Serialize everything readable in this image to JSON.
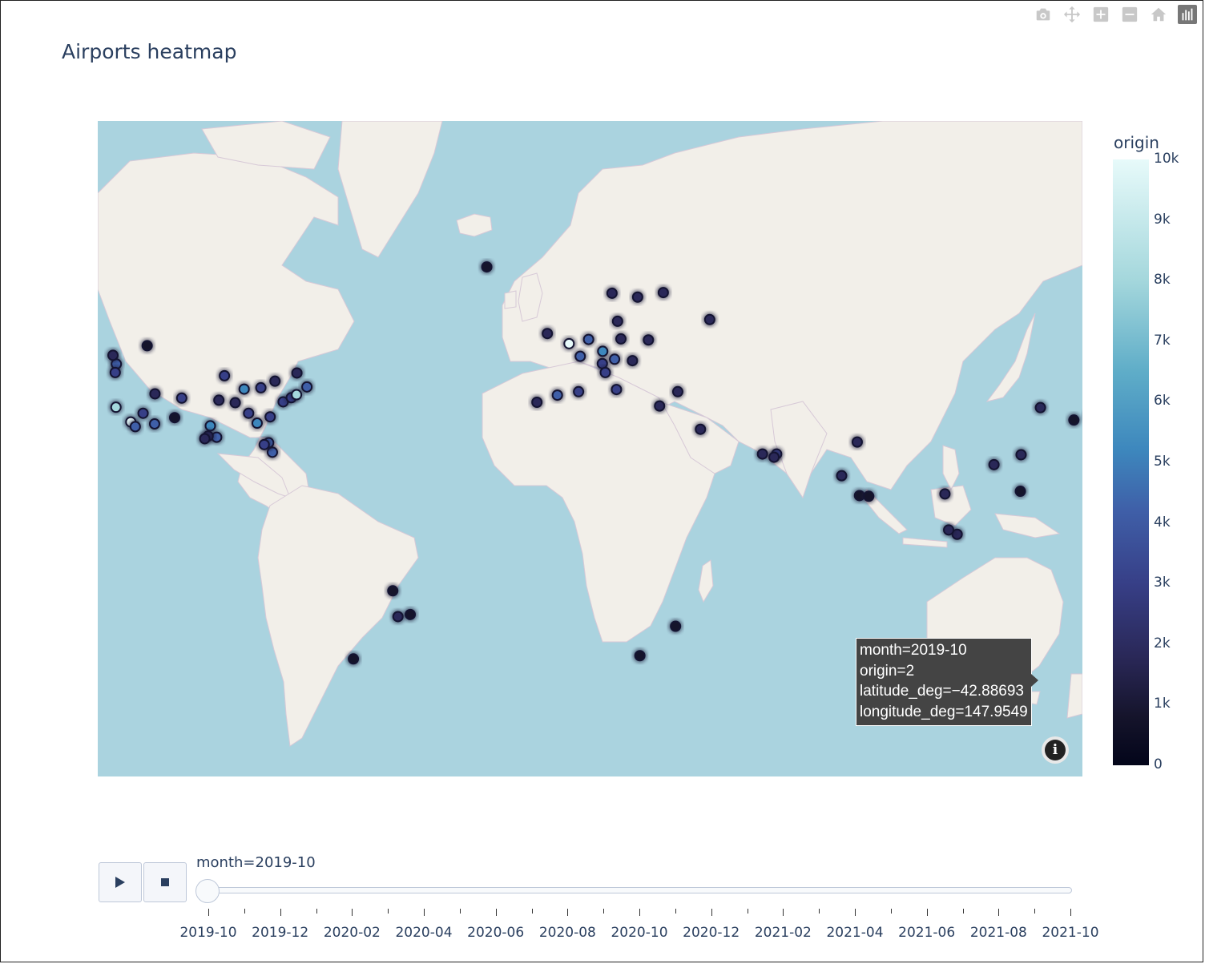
{
  "title": "Airports heatmap",
  "modebar": [
    {
      "name": "camera-icon"
    },
    {
      "name": "pan-icon"
    },
    {
      "name": "zoom-in-icon"
    },
    {
      "name": "zoom-out-icon"
    },
    {
      "name": "home-icon"
    },
    {
      "name": "plotly-logo-icon"
    }
  ],
  "colorbar": {
    "title": "origin",
    "ticks": [
      "10k",
      "9k",
      "8k",
      "7k",
      "6k",
      "5k",
      "4k",
      "3k",
      "2k",
      "1k",
      "0"
    ],
    "colors": [
      "#e7fafa",
      "#a4d7dc",
      "#5fadc8",
      "#3d87bd",
      "#3f5fa8",
      "#373f87",
      "#2a2858",
      "#15142b",
      "#03051a"
    ]
  },
  "tooltip": {
    "line1": "month=2019-10",
    "line2": "origin=2",
    "line3": "latitude_deg=−42.88693",
    "line4": "longitude_deg=147.9549"
  },
  "slider": {
    "current_label": "month=2019-10",
    "play_icon": "play-icon",
    "stop_icon": "stop-icon",
    "ticks": [
      "2019-10",
      "2019-12",
      "2020-02",
      "2020-04",
      "2020-06",
      "2020-08",
      "2020-10",
      "2020-12",
      "2021-02",
      "2021-04",
      "2021-06",
      "2021-08",
      "2021-10"
    ],
    "current_index": 0
  },
  "chart_data": {
    "type": "heatmap",
    "map_type": "density_mapbox",
    "z_name": "origin",
    "z_range": [
      0,
      10000
    ],
    "frame": "2019-10",
    "points": [
      {
        "lon": -122.4,
        "lat": 37.6,
        "z": 8500
      },
      {
        "lon": -118.4,
        "lat": 33.9,
        "z": 9800
      },
      {
        "lon": -117.2,
        "lat": 32.7,
        "z": 4500
      },
      {
        "lon": -112.0,
        "lat": 33.4,
        "z": 5200
      },
      {
        "lon": -115.1,
        "lat": 36.1,
        "z": 4200
      },
      {
        "lon": -122.3,
        "lat": 47.4,
        "z": 4800
      },
      {
        "lon": -122.6,
        "lat": 45.6,
        "z": 3500
      },
      {
        "lon": -104.7,
        "lat": 39.8,
        "z": 3900
      },
      {
        "lon": -111.9,
        "lat": 40.8,
        "z": 2600
      },
      {
        "lon": -97.0,
        "lat": 32.9,
        "z": 6000
      },
      {
        "lon": -95.3,
        "lat": 29.9,
        "z": 5400
      },
      {
        "lon": -97.6,
        "lat": 30.2,
        "z": 3000
      },
      {
        "lon": -98.5,
        "lat": 29.5,
        "z": 2000
      },
      {
        "lon": -90.3,
        "lat": 38.7,
        "z": 2500
      },
      {
        "lon": -87.9,
        "lat": 41.9,
        "z": 6200
      },
      {
        "lon": -84.4,
        "lat": 33.6,
        "z": 6600
      },
      {
        "lon": -86.7,
        "lat": 36.1,
        "z": 3200
      },
      {
        "lon": -80.9,
        "lat": 35.2,
        "z": 4300
      },
      {
        "lon": -80.3,
        "lat": 25.8,
        "z": 4700
      },
      {
        "lon": -81.3,
        "lat": 28.4,
        "z": 5000
      },
      {
        "lon": -82.5,
        "lat": 27.9,
        "z": 3300
      },
      {
        "lon": -77.4,
        "lat": 38.9,
        "z": 4300
      },
      {
        "lon": -75.2,
        "lat": 39.9,
        "z": 3700
      },
      {
        "lon": -73.8,
        "lat": 40.6,
        "z": 9200
      },
      {
        "lon": -71.0,
        "lat": 42.4,
        "z": 5000
      },
      {
        "lon": -83.4,
        "lat": 42.2,
        "z": 3800
      },
      {
        "lon": -93.2,
        "lat": 44.9,
        "z": 3600
      },
      {
        "lon": -94.7,
        "lat": 39.3,
        "z": 2200
      },
      {
        "lon": -106.6,
        "lat": 35.0,
        "z": 1800
      },
      {
        "lon": -79.6,
        "lat": 43.7,
        "z": 2700
      },
      {
        "lon": -73.7,
        "lat": 45.5,
        "z": 2600
      },
      {
        "lon": -123.2,
        "lat": 49.2,
        "z": 2200
      },
      {
        "lon": -114.0,
        "lat": 51.1,
        "z": 1300
      },
      {
        "lon": -0.45,
        "lat": 51.5,
        "z": 9400
      },
      {
        "lon": 2.55,
        "lat": 49.0,
        "z": 5600
      },
      {
        "lon": 8.6,
        "lat": 50.0,
        "z": 6000
      },
      {
        "lon": 4.8,
        "lat": 52.3,
        "z": 5200
      },
      {
        "lon": 11.8,
        "lat": 48.4,
        "z": 4900
      },
      {
        "lon": 8.5,
        "lat": 47.5,
        "z": 3600
      },
      {
        "lon": -3.6,
        "lat": 40.5,
        "z": 4400
      },
      {
        "lon": 2.1,
        "lat": 41.3,
        "z": 3900
      },
      {
        "lon": 12.3,
        "lat": 41.8,
        "z": 3500
      },
      {
        "lon": 9.3,
        "lat": 45.6,
        "z": 3200
      },
      {
        "lon": 16.6,
        "lat": 48.1,
        "z": 2600
      },
      {
        "lon": 13.5,
        "lat": 52.4,
        "z": 2800
      },
      {
        "lon": 12.6,
        "lat": 55.6,
        "z": 2200
      },
      {
        "lon": 18.0,
        "lat": 59.6,
        "z": 2400
      },
      {
        "lon": 11.1,
        "lat": 60.2,
        "z": 2100
      },
      {
        "lon": 24.9,
        "lat": 60.3,
        "z": 2000
      },
      {
        "lon": 20.9,
        "lat": 52.2,
        "z": 2300
      },
      {
        "lon": 28.8,
        "lat": 41.3,
        "z": 2600
      },
      {
        "lon": 37.4,
        "lat": 55.9,
        "z": 3000
      },
      {
        "lon": -9.1,
        "lat": 38.8,
        "z": 2700
      },
      {
        "lon": -6.3,
        "lat": 53.4,
        "z": 2900
      },
      {
        "lon": 23.9,
        "lat": 37.9,
        "z": 2200
      },
      {
        "lon": 34.9,
        "lat": 32.0,
        "z": 2000
      },
      {
        "lon": 55.4,
        "lat": 25.3,
        "z": 3500
      },
      {
        "lon": 51.6,
        "lat": 25.3,
        "z": 2500
      },
      {
        "lon": 54.7,
        "lat": 24.4,
        "z": 2500
      },
      {
        "lon": 77.1,
        "lat": 28.6,
        "z": 2000
      },
      {
        "lon": 72.9,
        "lat": 19.1,
        "z": 2100
      },
      {
        "lon": 77.7,
        "lat": 13.2,
        "z": 1600
      },
      {
        "lon": 80.2,
        "lat": 13.0,
        "z": 1600
      },
      {
        "lon": 100.7,
        "lat": 13.7,
        "z": 1900
      },
      {
        "lon": 103.99,
        "lat": 1.36,
        "z": 3000
      },
      {
        "lon": 101.7,
        "lat": 2.7,
        "z": 2000
      },
      {
        "lon": 113.9,
        "lat": 22.3,
        "z": 2600
      },
      {
        "lon": 121.2,
        "lat": 25.1,
        "z": 2400
      },
      {
        "lon": 121.0,
        "lat": 14.5,
        "z": 1600
      },
      {
        "lon": 126.4,
        "lat": 37.5,
        "z": 2300
      },
      {
        "lon": 135.4,
        "lat": 34.4,
        "z": 1500
      },
      {
        "lon": 139.8,
        "lat": 35.6,
        "z": 2000
      },
      {
        "lon": 140.4,
        "lat": 35.8,
        "z": 1600
      },
      {
        "lon": 151.2,
        "lat": -33.9,
        "z": 3700
      },
      {
        "lon": 153.1,
        "lat": -27.4,
        "z": 2400
      },
      {
        "lon": 144.8,
        "lat": -37.7,
        "z": 2800
      },
      {
        "lon": 115.97,
        "lat": -31.9,
        "z": 1300
      },
      {
        "lon": 147.95,
        "lat": -42.89,
        "z": 2
      },
      {
        "lon": -46.5,
        "lat": -23.4,
        "z": 1900
      },
      {
        "lon": -43.2,
        "lat": -22.8,
        "z": 1500
      },
      {
        "lon": -47.9,
        "lat": -15.9,
        "z": 900
      },
      {
        "lon": 28.2,
        "lat": -26.1,
        "z": 1800
      },
      {
        "lon": 18.6,
        "lat": -33.97,
        "z": 1200
      },
      {
        "lon": -22.6,
        "lat": 64.0,
        "z": 1100
      },
      {
        "lon": -58.5,
        "lat": -34.8,
        "z": 800
      }
    ]
  }
}
